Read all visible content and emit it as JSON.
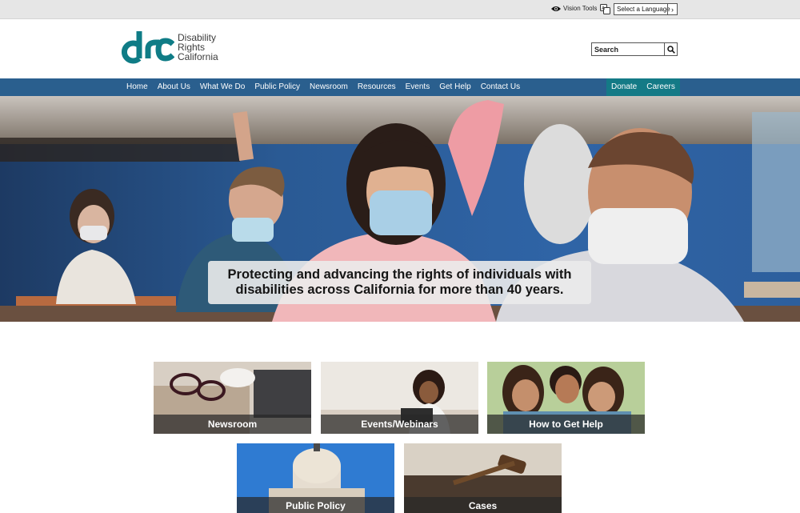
{
  "utility": {
    "vision_tools": "Vision Tools",
    "language_select": "Select a Language"
  },
  "header": {
    "logo_lines": [
      "Disability",
      "Rights",
      "California"
    ],
    "search_placeholder": "Search"
  },
  "nav": {
    "items": [
      "Home",
      "About Us",
      "What We Do",
      "Public Policy",
      "Newsroom",
      "Resources",
      "Events",
      "Get Help",
      "Contact Us"
    ],
    "right_items": [
      "Donate",
      "Careers"
    ]
  },
  "hero": {
    "caption_line1": "Protecting and advancing the rights of individuals with",
    "caption_line2": "disabilities across California for more than 40 years."
  },
  "tiles": [
    {
      "label": "Newsroom"
    },
    {
      "label": "Events/Webinars"
    },
    {
      "label": "How to Get Help"
    },
    {
      "label": "Public Policy"
    },
    {
      "label": "Cases"
    }
  ],
  "colors": {
    "nav_bg": "#2a5f8e",
    "nav_right_bg": "#147a86",
    "logo_teal": "#0f7c86"
  }
}
